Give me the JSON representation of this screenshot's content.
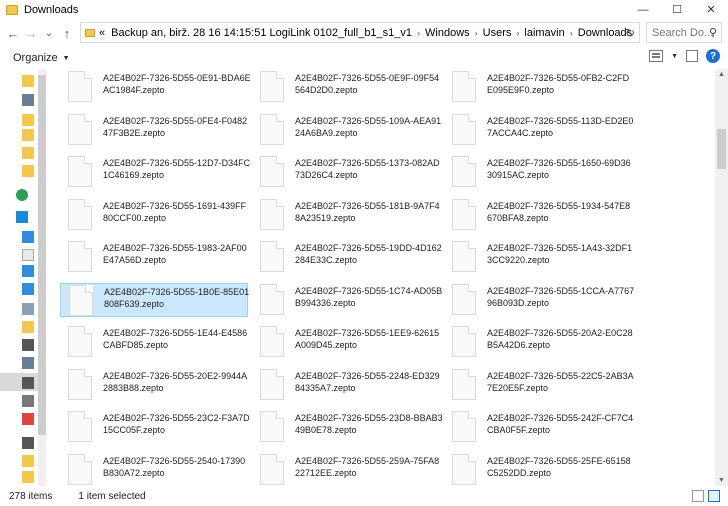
{
  "window": {
    "title": "Downloads",
    "minimize": "—",
    "maximize": "☐",
    "close": "✕"
  },
  "nav": {
    "back": "←",
    "forward": "→",
    "recent": "⌄",
    "up": "↑",
    "overflow": "«",
    "path": [
      "Backup an, birž. 28 16 14:15:51 LogiLink 0102_full_b1_s1_v1",
      "Windows",
      "Users",
      "laimavin",
      "Downloads"
    ],
    "sep": "›",
    "refresh": "↻",
    "search_placeholder": "Search Do..."
  },
  "toolbar": {
    "organize": "Organize",
    "help": "?"
  },
  "files": [
    [
      "A2E4B02F-7326-5D55-0E91-BDA6EAC1984F.zepto",
      "A2E4B02F-7326-5D55-0E9F-09F54564D2D0.zepto",
      "A2E4B02F-7326-5D55-0FB2-C2FDE095E9F0.zepto"
    ],
    [
      "A2E4B02F-7326-5D55-0FE4-F048247F3B2E.zepto",
      "A2E4B02F-7326-5D55-109A-AEA9124A6BA9.zepto",
      "A2E4B02F-7326-5D55-113D-ED2E07ACCA4C.zepto"
    ],
    [
      "A2E4B02F-7326-5D55-12D7-D34FC1C46169.zepto",
      "A2E4B02F-7326-5D55-1373-082AD73D26C4.zepto",
      "A2E4B02F-7326-5D55-1650-69D3630915AC.zepto"
    ],
    [
      "A2E4B02F-7326-5D55-1691-439FF80CCF00.zepto",
      "A2E4B02F-7326-5D55-181B-9A7F48A23519.zepto",
      "A2E4B02F-7326-5D55-1934-547E8670BFA8.zepto"
    ],
    [
      "A2E4B02F-7326-5D55-1983-2AF00E47A56D.zepto",
      "A2E4B02F-7326-5D55-19DD-4D162284E33C.zepto",
      "A2E4B02F-7326-5D55-1A43-32DF13CC9220.zepto"
    ],
    [
      "A2E4B02F-7326-5D55-1B0E-85E01808F639.zepto",
      "A2E4B02F-7326-5D55-1C74-AD05BB994336.zepto",
      "A2E4B02F-7326-5D55-1CCA-A776796B093D.zepto"
    ],
    [
      "A2E4B02F-7326-5D55-1E44-E4586CABFD85.zepto",
      "A2E4B02F-7326-5D55-1EE9-62615A009D45.zepto",
      "A2E4B02F-7326-5D55-20A2-E0C28B5A42D6.zepto"
    ],
    [
      "A2E4B02F-7326-5D55-20E2-9944A2883B88.zepto",
      "A2E4B02F-7326-5D55-2248-ED32984335A7.zepto",
      "A2E4B02F-7326-5D55-22C5-2AB3A7E20E5F.zepto"
    ],
    [
      "A2E4B02F-7326-5D55-23C2-F3A7D15CC05F.zepto",
      "A2E4B02F-7326-5D55-23D8-BBAB349B0E78.zepto",
      "A2E4B02F-7326-5D55-242F-CF7C4CBA0F5F.zepto"
    ],
    [
      "A2E4B02F-7326-5D55-2540-17390B830A72.zepto",
      "A2E4B02F-7326-5D55-259A-75FA822712EE.zepto",
      "A2E4B02F-7326-5D55-25FE-65158C5252DD.zepto"
    ]
  ],
  "selected": {
    "row": 5,
    "col": 0
  },
  "status": {
    "items": "278 items",
    "selected": "1 item selected"
  }
}
